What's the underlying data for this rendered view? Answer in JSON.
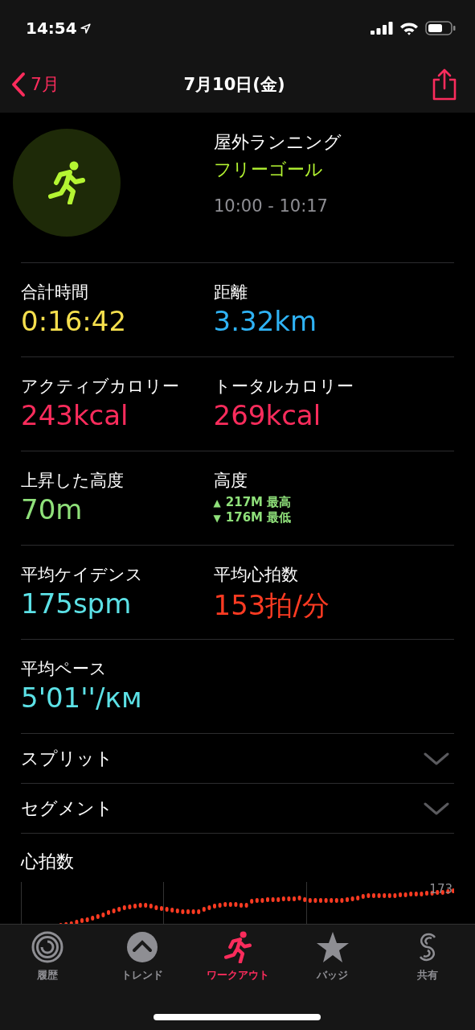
{
  "status_bar": {
    "time": "14:54"
  },
  "nav": {
    "back": "7月",
    "title": "7月10日(金)"
  },
  "workout": {
    "type": "屋外ランニング",
    "goal": "フリーゴール",
    "time_range": "10:00 - 10:17"
  },
  "metrics": [
    [
      {
        "kind": "value",
        "label": "合計時間",
        "value": "0:16:42",
        "color": "#f5df4d"
      },
      {
        "kind": "value",
        "label": "距離",
        "value": "3.32km",
        "color": "#2fb3f5"
      }
    ],
    [
      {
        "kind": "value",
        "label": "アクティブカロリー",
        "value": "243kcal",
        "color": "#fa2c5c"
      },
      {
        "kind": "value",
        "label": "トータルカロリー",
        "value": "269kcal",
        "color": "#fa2c5c"
      }
    ],
    [
      {
        "kind": "value",
        "label": "上昇した高度",
        "value": "70m",
        "color": "#8fe07a"
      },
      {
        "kind": "elevation",
        "label": "高度",
        "high_mark": "▲",
        "high": "217M 最高",
        "low_mark": "▼",
        "low": "176M 最低",
        "color": "#8fe07a"
      }
    ],
    [
      {
        "kind": "value",
        "label": "平均ケイデンス",
        "value": "175spm",
        "color": "#5ce1e6"
      },
      {
        "kind": "value",
        "label": "平均心拍数",
        "value": "153拍/分",
        "color": "#ff3b22"
      }
    ],
    [
      {
        "kind": "value",
        "label": "平均ペース",
        "value": "5'01''/км",
        "color": "#5ce1e6"
      }
    ]
  ],
  "sections": [
    {
      "label": "スプリット",
      "expanded": false
    },
    {
      "label": "セグメント",
      "expanded": false
    }
  ],
  "heart_rate": {
    "title": "心拍数",
    "max_label": "173"
  },
  "tabs": [
    {
      "label": "履歴",
      "selected": false
    },
    {
      "label": "トレンド",
      "selected": false
    },
    {
      "label": "ワークアウト",
      "selected": true
    },
    {
      "label": "バッジ",
      "selected": false
    },
    {
      "label": "共有",
      "selected": false
    }
  ]
}
